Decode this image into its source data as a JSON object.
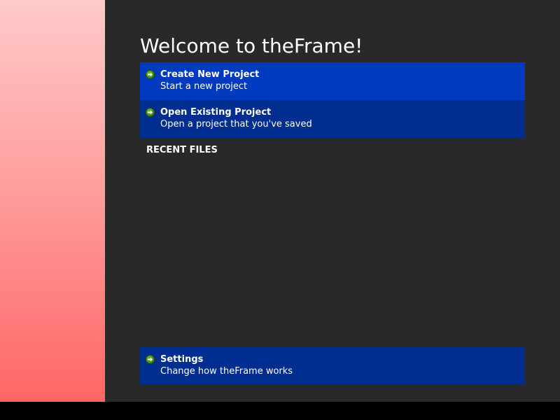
{
  "welcome": {
    "title": "Welcome to theFrame!"
  },
  "actions": [
    {
      "title": "Create New Project",
      "subtitle": "Start a new project",
      "color": "#003bbf",
      "icon": "arrow-right-icon"
    },
    {
      "title": "Open Existing Project",
      "subtitle": "Open a project that you've saved",
      "color": "#002e90",
      "icon": "arrow-right-icon"
    }
  ],
  "recent": {
    "heading": "RECENT FILES",
    "items": []
  },
  "settings": {
    "title": "Settings",
    "subtitle": "Change how theFrame works",
    "color": "#002e90",
    "icon": "arrow-right-icon"
  },
  "colors": {
    "background": "#292929",
    "taskbar": "#000000",
    "side_gradient_top": "#ffcaca",
    "side_gradient_bottom": "#ff6666",
    "icon_green": "#3f8a1a"
  }
}
